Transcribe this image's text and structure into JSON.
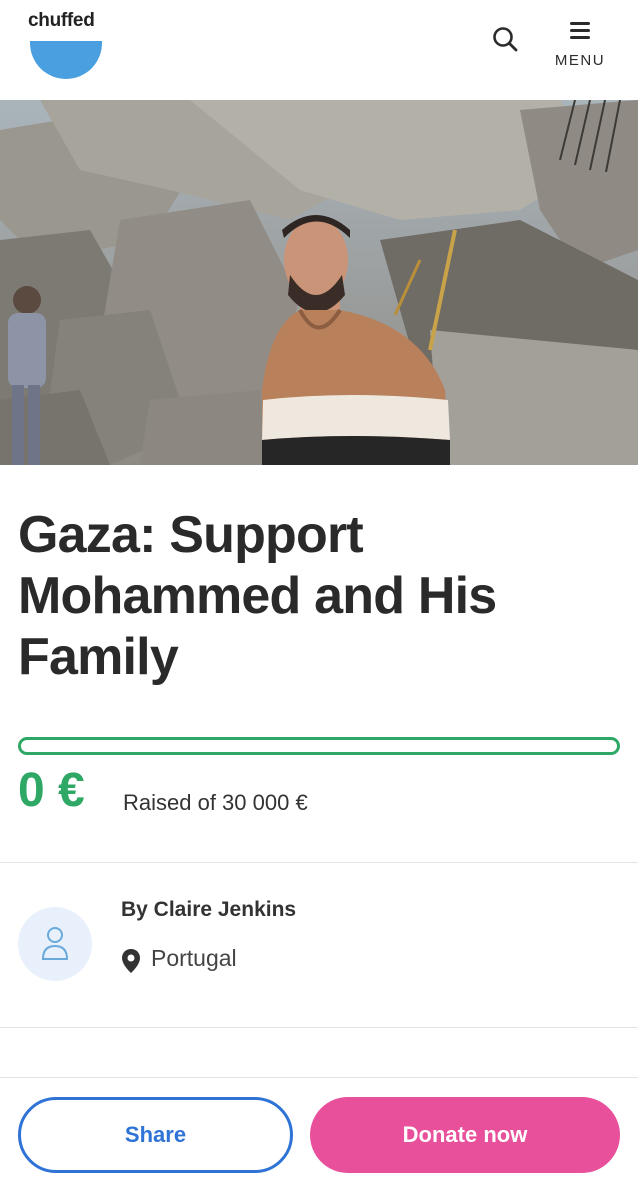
{
  "header": {
    "logo_text": "chuffed",
    "search_icon": "search-icon",
    "menu_icon": "hamburger-menu-icon",
    "menu_label": "MENU"
  },
  "hero": {
    "image": "man-in-striped-hoodie-standing-before-rubble"
  },
  "campaign": {
    "title": "Gaza: Support Mohammed and His Family",
    "amount_raised": "0 €",
    "raised_text": "Raised of 30 000 €",
    "progress_fraction": 0
  },
  "organizer": {
    "by_text": "By Claire Jenkins",
    "avatar_icon": "user-icon",
    "location_icon": "map-pin-icon",
    "location": "Portugal"
  },
  "actions": {
    "share_label": "Share",
    "donate_label": "Donate now"
  },
  "colors": {
    "brand_blue": "#4a9fe0",
    "progress_green": "#2fa866",
    "share_blue": "#2f73d6",
    "donate_pink": "#e8509c"
  }
}
